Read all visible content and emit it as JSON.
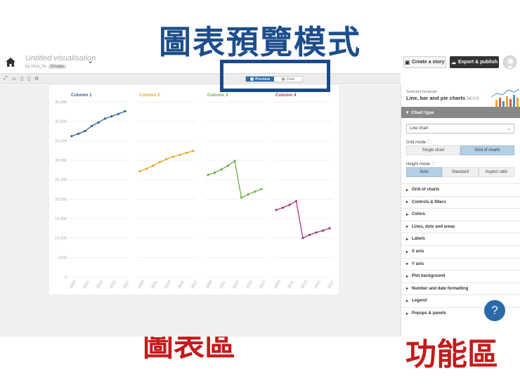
{
  "annotations": {
    "top": "圖表預覽模式",
    "chart_area": "圖表區",
    "function_area": "功能區"
  },
  "header": {
    "title": "Untitled visualisation",
    "byline": "by chris_liu",
    "privacy": "Private",
    "create_story": "Create a story",
    "export_publish": "Export & publish"
  },
  "toolbar": {
    "tabs": [
      "Preview",
      "Data"
    ]
  },
  "panel": {
    "selected_template_label": "Selected template",
    "template_name": "Line, bar and pie charts",
    "template_version": "24.0.0",
    "section_title": "Chart type",
    "chart_type_value": "Line chart",
    "grid_mode_label": "Grid mode",
    "grid_mode_options": [
      "Single chart",
      "Grid of charts"
    ],
    "grid_mode_selected": "Grid of charts",
    "height_mode_label": "Height mode",
    "height_mode_options": [
      "Auto",
      "Standard",
      "Aspect ratio"
    ],
    "height_mode_selected": "Auto",
    "accordion": [
      "Grid of charts",
      "Controls & filters",
      "Colors",
      "Lines, dots and areas",
      "Labels",
      "X axis",
      "Y axis",
      "Plot background",
      "Number and date formatting",
      "Legend",
      "Popups & panels"
    ],
    "help": "?"
  },
  "colors": {
    "accent": "#2a6aa8",
    "annotation_blue": "#1d4e8c",
    "annotation_red": "#c51a1a"
  },
  "chart_data": {
    "type": "line",
    "layout": "grid",
    "ylim": [
      0,
      45000
    ],
    "yticks": [
      "0",
      "5000",
      "10,000",
      "15,000",
      "20,000",
      "25,000",
      "30,000",
      "35,000",
      "40,000",
      "45,000"
    ],
    "xticks": [
      "2009",
      "2011",
      "2013",
      "2015",
      "2017"
    ],
    "x": [
      2009,
      2010,
      2011,
      2012,
      2013,
      2014,
      2015,
      2016,
      2017
    ],
    "series": [
      {
        "name": "Column 1",
        "color": "#2c5f94",
        "values": [
          36200,
          36800,
          37500,
          38800,
          39700,
          40700,
          41300,
          41900,
          42600
        ]
      },
      {
        "name": "Column 2",
        "color": "#e8a62a",
        "values": [
          27200,
          27800,
          28600,
          29500,
          30300,
          30900,
          31400,
          31900,
          32400
        ]
      },
      {
        "name": "Column 3",
        "color": "#6aab45",
        "values": [
          26200,
          26800,
          27600,
          28600,
          29800,
          20400,
          21200,
          21900,
          22600
        ]
      },
      {
        "name": "Column 4",
        "color": "#a8357d",
        "values": [
          17200,
          17800,
          18500,
          19500,
          10000,
          10800,
          11400,
          11900,
          12500
        ]
      }
    ]
  }
}
